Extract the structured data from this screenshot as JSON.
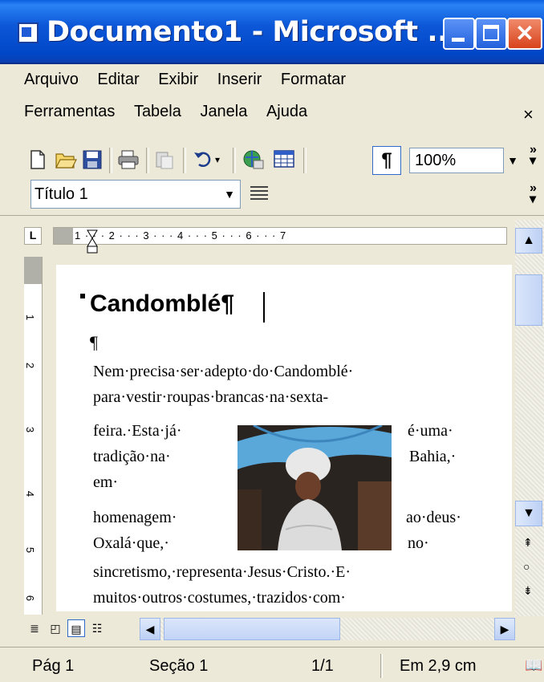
{
  "window": {
    "title": "Documento1 - Microsoft ..."
  },
  "menu": {
    "row1": [
      "Arquivo",
      "Editar",
      "Exibir",
      "Inserir",
      "Formatar"
    ],
    "row2": [
      "Ferramentas",
      "Tabela",
      "Janela",
      "Ajuda"
    ],
    "close_glyph": "×"
  },
  "toolbar": {
    "buttons": [
      "new-icon",
      "open-icon",
      "save-icon",
      "print-icon",
      "paste-icon",
      "undo-icon",
      "web-icon",
      "table-icon"
    ],
    "show_formatting_glyph": "¶",
    "zoom": "100%",
    "more_glyph": "»"
  },
  "formatting": {
    "style": "Título 1",
    "more_glyph": "»"
  },
  "ruler": {
    "tab_glyph": "L",
    "numbers": "1 · · · 2 · · · 3 · · · 4 · · · 5 · · · 6 · · · 7",
    "vertical_numbers": [
      "1",
      "2",
      "3",
      "4",
      "5",
      "6"
    ]
  },
  "document": {
    "heading": "Candomblé¶",
    "empty_paragraph": "¶",
    "lines": [
      "Nem·precisa·ser·adepto·do·Candomblé·",
      "para·vestir·roupas·brancas·na·sexta-",
      "feira.·Esta·já·",
      "tradição·na·",
      "em·",
      "homenagem·",
      "Oxalá·que,·",
      "sincretismo,·representa·Jesus·Cristo.·E·",
      "muitos·outros·costumes,·trazidos·com·"
    ],
    "right_column": [
      "é·uma·",
      "Bahia,·",
      "ao·deus·",
      "no·"
    ],
    "image": "baiana-photo"
  },
  "statusbar": {
    "page": "Pág 1",
    "section": "Seção 1",
    "pages": "1/1",
    "position": "Em 2,9 cm"
  }
}
